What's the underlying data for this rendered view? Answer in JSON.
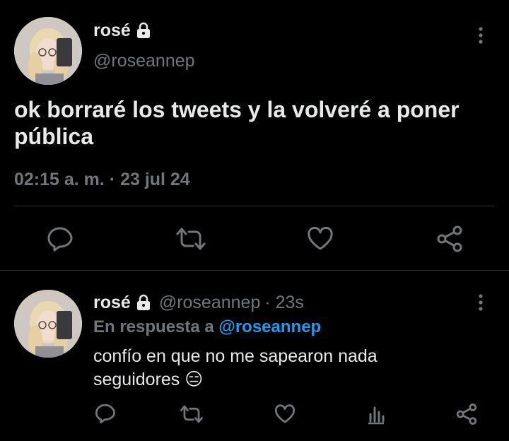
{
  "main_tweet": {
    "display_name": "rosé",
    "handle": "@roseannep",
    "text": "ok borraré los tweets y la volveré a poner pública",
    "timestamp": "02:15 a. m. · 23 jul 24",
    "icons": [
      "lock-icon",
      "more-icon",
      "reply-icon",
      "retweet-icon",
      "like-icon",
      "share-icon"
    ]
  },
  "reply_tweet": {
    "display_name": "rosé",
    "handle": "@roseannep",
    "time": "· 23s",
    "replying_prefix": "En respuesta a",
    "replying_to": "@roseannep",
    "text": "confío en que no me sapearon nada seguidores 😑",
    "icons": [
      "lock-icon",
      "more-icon",
      "reply-icon",
      "retweet-icon",
      "like-icon",
      "views-icon",
      "share-icon"
    ]
  },
  "colors": {
    "background": "#000000",
    "text": "#e7e9ea",
    "muted": "#71767b",
    "link": "#1d9bf0",
    "divider": "#2f3336"
  }
}
